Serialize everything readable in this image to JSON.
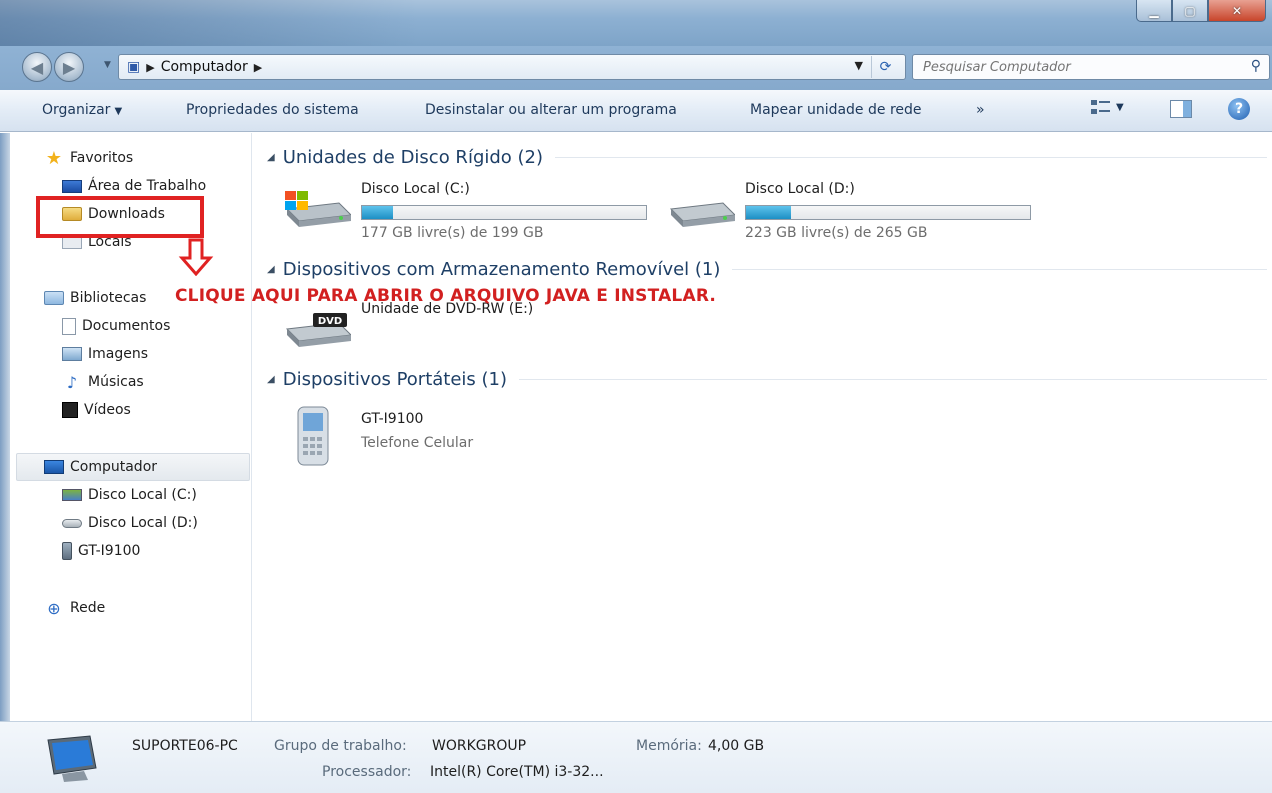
{
  "address": {
    "crumbs": [
      "Computador"
    ],
    "search_placeholder": "Pesquisar Computador"
  },
  "toolbar": {
    "organize": "Organizar",
    "system_properties": "Propriedades do sistema",
    "uninstall": "Desinstalar ou alterar um programa",
    "map_drive": "Mapear unidade de rede",
    "more": "»"
  },
  "sidebar": {
    "favorites": "Favoritos",
    "desktop": "Área de Trabalho",
    "downloads": "Downloads",
    "places": "Locais",
    "libraries": "Bibliotecas",
    "documents": "Documentos",
    "images": "Imagens",
    "music": "Músicas",
    "videos": "Vídeos",
    "computer": "Computador",
    "disk_c": "Disco Local (C:)",
    "disk_d": "Disco Local (D:)",
    "phone": "GT-I9100",
    "network": "Rede"
  },
  "annotation": {
    "instruction": "CLIQUE AQUI PARA ABRIR O ARQUIVO JAVA E INSTALAR."
  },
  "groups": {
    "hard_drives": "Unidades de Disco Rígido (2)",
    "removable": "Dispositivos com Armazenamento Removível (1)",
    "portable": "Dispositivos Portáteis (1)"
  },
  "drives": [
    {
      "name": "Disco Local (C:)",
      "free_text": "177 GB livre(s) de 199 GB",
      "used_fraction": 0.11
    },
    {
      "name": "Disco Local (D:)",
      "free_text": "223 GB livre(s) de 265 GB",
      "used_fraction": 0.16
    }
  ],
  "dvd": {
    "name": "Unidade de DVD-RW (E:)",
    "badge": "DVD"
  },
  "portable_device": {
    "name": "GT-I9100",
    "type": "Telefone Celular"
  },
  "details": {
    "pc_name": "SUPORTE06-PC",
    "workgroup_label": "Grupo de trabalho:",
    "workgroup_value": "WORKGROUP",
    "memory_label": "Memória:",
    "memory_value": "4,00 GB",
    "processor_label": "Processador:",
    "processor_value": "Intel(R) Core(TM) i3-32..."
  },
  "colors": {
    "annotation_red": "#d22020",
    "drive_bar_fill": "#1d8fc4",
    "group_title": "#1e3f66"
  }
}
